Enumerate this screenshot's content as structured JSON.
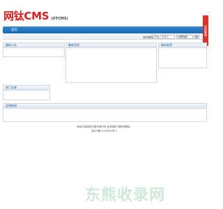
{
  "header": {
    "logo_main": "网钛CMS",
    "logo_sub": "(OTCMS)"
  },
  "nav": {
    "home_label": "首页"
  },
  "search": {
    "label": "站内搜索",
    "placeholder": "请输入关键字",
    "scope_value": "标题搜索",
    "button_label": "搜"
  },
  "side_tab": {
    "label": "在线客服"
  },
  "panels": {
    "latest_notice": "最新公告",
    "latest_news": "最新消息",
    "recommended": "精彩推荐",
    "hot_articles": "热门文章",
    "friend_links": "友情链接"
  },
  "footer": {
    "line1": "网站内容版权归原作者所有,如有侵权,请联系删除。",
    "line2": "粤ICP备12345678号-1"
  },
  "watermark": {
    "text": "东熊收录网"
  }
}
